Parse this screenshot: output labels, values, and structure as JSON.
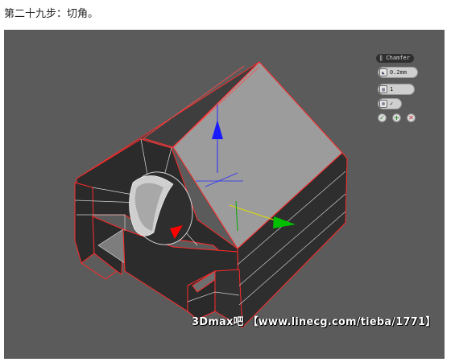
{
  "caption": "第二十九步：切角。",
  "caddy": {
    "title": "Chamfer",
    "amount": "0.2mm",
    "segments": "1",
    "ok_icon": "check-icon",
    "apply_icon": "plus-icon",
    "cancel_icon": "close-icon"
  },
  "watermark": "3Dmax吧 【www.linecg.com/tieba/1771】",
  "colors": {
    "viewport_bg": "#5b5b5b",
    "edge_selected": "#ff2020",
    "gizmo_z": "#1a1aff",
    "gizmo_x": "#ff0000",
    "gizmo_y": "#00c000"
  }
}
